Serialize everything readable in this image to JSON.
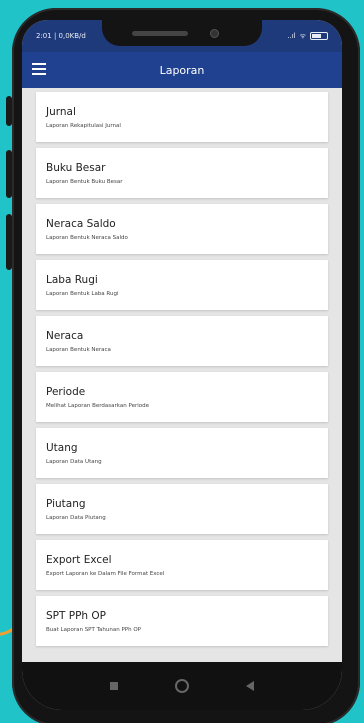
{
  "status": {
    "time": "2:01 | 0,0KB/d",
    "signal": "..ıl",
    "wifi": "ᯤ"
  },
  "appbar": {
    "title": "Laporan"
  },
  "menu": [
    {
      "title": "Jurnal",
      "subtitle": "Laporan Rekapitulasi Jurnal"
    },
    {
      "title": "Buku Besar",
      "subtitle": "Laporan Bentuk Buku Besar"
    },
    {
      "title": "Neraca Saldo",
      "subtitle": "Laporan Bentuk Neraca Saldo"
    },
    {
      "title": "Laba Rugi",
      "subtitle": "Laporan Bentuk Laba Rugi"
    },
    {
      "title": "Neraca",
      "subtitle": "Laporan Bentuk Neraca"
    },
    {
      "title": "Periode",
      "subtitle": "Melihat Laporan Berdasarkan Periode"
    },
    {
      "title": "Utang",
      "subtitle": "Laporan Data Utang"
    },
    {
      "title": "Piutang",
      "subtitle": "Laporan Data Piutang"
    },
    {
      "title": "Export Excel",
      "subtitle": "Export Laporan ke Dalam File Format Excel"
    },
    {
      "title": "SPT PPh OP",
      "subtitle": "Buat Laporan SPT Tahunan PPh OP"
    }
  ],
  "colors": {
    "background": "#20c4c8",
    "appbar": "#20418f",
    "statusbar": "#1f3a7a",
    "accent_line": "#f0a030"
  }
}
